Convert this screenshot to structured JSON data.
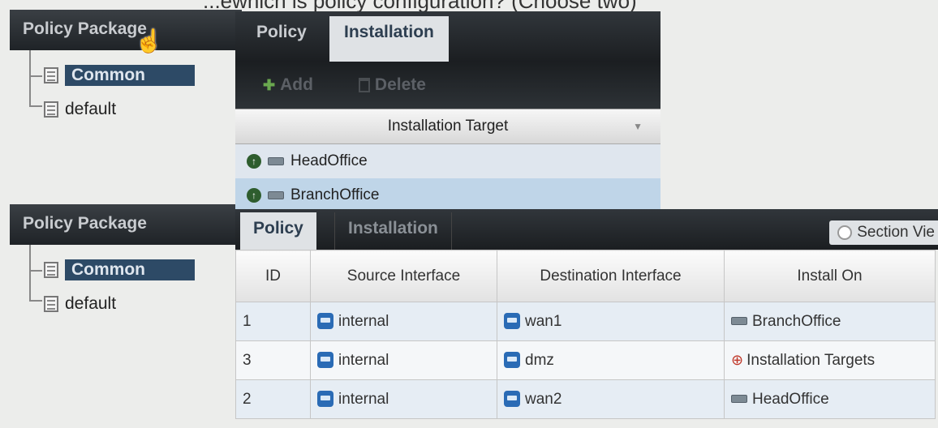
{
  "question": {
    "text": "...ewhich is policy configuration? (Choose two)"
  },
  "top_package_panel": {
    "title": "Policy Package",
    "items": [
      {
        "label": "Common",
        "selected": true
      },
      {
        "label": "default",
        "selected": false
      }
    ]
  },
  "bottom_package_panel": {
    "title": "Policy Package",
    "items": [
      {
        "label": "Common",
        "selected": true
      },
      {
        "label": "default",
        "selected": false
      }
    ]
  },
  "top_window": {
    "tabs": {
      "policy": "Policy",
      "installation": "Installation"
    },
    "toolbar": {
      "add_label": "Add",
      "delete_label": "Delete"
    },
    "column_header": "Installation Target",
    "targets": [
      {
        "name": "HeadOffice",
        "selected": false
      },
      {
        "name": "BranchOffice",
        "selected": true
      }
    ]
  },
  "bottom_window": {
    "tabs": {
      "policy": "Policy",
      "installation": "Installation"
    },
    "section_view_label": "Section Vie",
    "table": {
      "headers": [
        "ID",
        "Source Interface",
        "Destination Interface",
        "Install On"
      ],
      "rows": [
        {
          "id": "1",
          "source": "internal",
          "destination": "wan1",
          "install_on": "BranchOffice",
          "install_icon": "device-icon"
        },
        {
          "id": "3",
          "source": "internal",
          "destination": "dmz",
          "install_on": "Installation Targets",
          "install_icon": "target-icon"
        },
        {
          "id": "2",
          "source": "internal",
          "destination": "wan2",
          "install_on": "HeadOffice",
          "install_icon": "device-icon"
        }
      ]
    }
  }
}
